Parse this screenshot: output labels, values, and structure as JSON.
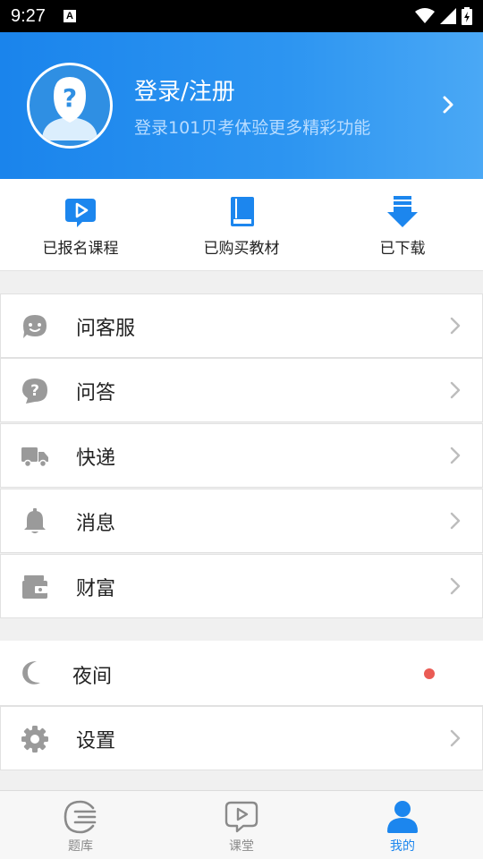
{
  "status_bar": {
    "time": "9:27",
    "notification_glyph": "A"
  },
  "header": {
    "title": "登录/注册",
    "subtitle": "登录101贝考体验更多精彩功能",
    "avatar_icon": "avatar-question-icon",
    "accent": "#1c86ee"
  },
  "quick_actions": [
    {
      "label": "已报名课程",
      "icon": "play-bubble-icon"
    },
    {
      "label": "已购买教材",
      "icon": "book-icon"
    },
    {
      "label": "已下载",
      "icon": "download-icon"
    }
  ],
  "menu": [
    {
      "label": "问客服",
      "icon": "customer-service-icon"
    },
    {
      "label": "问答",
      "icon": "question-bubble-icon"
    },
    {
      "label": "快递",
      "icon": "truck-icon"
    },
    {
      "label": "消息",
      "icon": "bell-icon"
    },
    {
      "label": "财富",
      "icon": "wallet-icon"
    }
  ],
  "night": {
    "label": "夜间",
    "icon": "moon-icon",
    "dot_color": "#ea5b54"
  },
  "settings": {
    "label": "设置",
    "icon": "gear-icon"
  },
  "tabs": [
    {
      "label": "题库",
      "icon": "question-bank-icon",
      "active": false
    },
    {
      "label": "课堂",
      "icon": "classroom-icon",
      "active": false
    },
    {
      "label": "我的",
      "icon": "profile-icon",
      "active": true
    }
  ]
}
